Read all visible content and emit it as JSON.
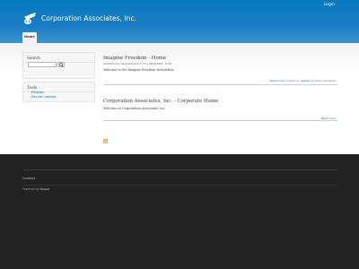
{
  "header": {
    "site_name": "Corporation Associates, Inc.",
    "login_label": "Login",
    "tab_home": "Home"
  },
  "sidebar": {
    "search_title": "Search",
    "tools_title": "Tools",
    "tools_links": [
      "Forums",
      "Recent content"
    ]
  },
  "nodes": [
    {
      "title": "Imagine Freedom - Home",
      "submitted": "Submitted by imaginefreedom on Thu, 08/20/2009 - 15:38",
      "body": "Welcome to the Imagine Freedom Newsletter",
      "links": {
        "read_more": "Read more",
        "sep1": " | ",
        "log_in": "Log in",
        "or": " or ",
        "register": "register",
        "to_post": " to post comments"
      }
    },
    {
      "title": "Corporation Associates, Inc. - Corporate Home",
      "body": "Welcome to Corporation Associates, Inc.",
      "links": {
        "read_more": "Read more"
      }
    }
  ],
  "footer": {
    "contact": "Contact",
    "powered_prefix": "Powered by ",
    "powered_link": "Drupal"
  },
  "colors": {
    "header_blue": "#1a7dc3",
    "link": "#0071b3",
    "footer_bg": "#222222",
    "rss": "#f59a2f"
  }
}
